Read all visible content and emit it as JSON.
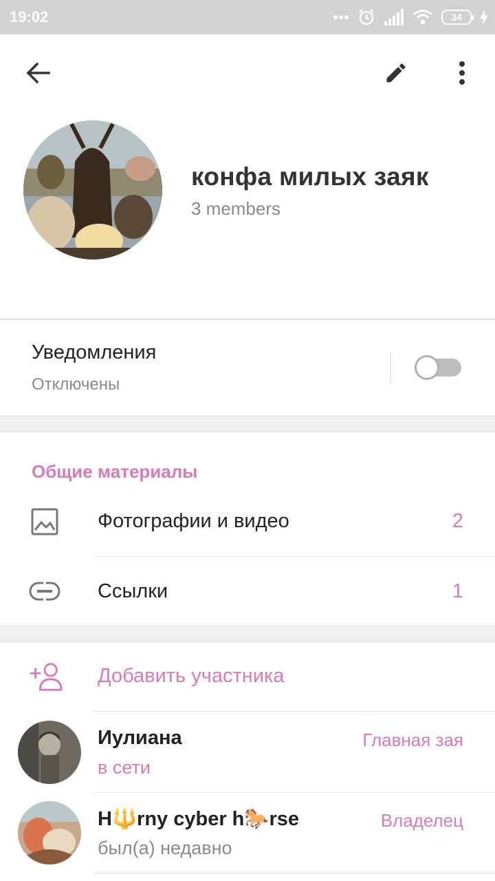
{
  "status_bar": {
    "time": "19:02",
    "battery": "34"
  },
  "toolbar": {
    "back_icon": "arrow-left-icon",
    "edit_icon": "pencil-icon",
    "menu_icon": "more-vert-icon"
  },
  "chat": {
    "title": "конфа милых заяк",
    "members": "3 members"
  },
  "notifications": {
    "title": "Уведомления",
    "subtitle": "Отключены",
    "enabled": false
  },
  "shared_media": {
    "header": "Общие материалы",
    "items": [
      {
        "label": "Фотографии и видео",
        "count": "2",
        "icon": "image-icon"
      },
      {
        "label": "Ссылки",
        "count": "1",
        "icon": "link-icon"
      }
    ]
  },
  "add_member": {
    "label": "Добавить участника",
    "icon": "add-person-icon"
  },
  "members": [
    {
      "name": "Иулиана",
      "status": "в сети",
      "role": "Главная зая",
      "online": true
    },
    {
      "name": "H🔱rny cyber h🐎rse",
      "status": "был(а) недавно",
      "role": "Владелец",
      "online": false
    }
  ],
  "colors": {
    "accent": "#d97bb6",
    "muted": "#8a8a8a",
    "status_bar": "#d2d2d2"
  }
}
